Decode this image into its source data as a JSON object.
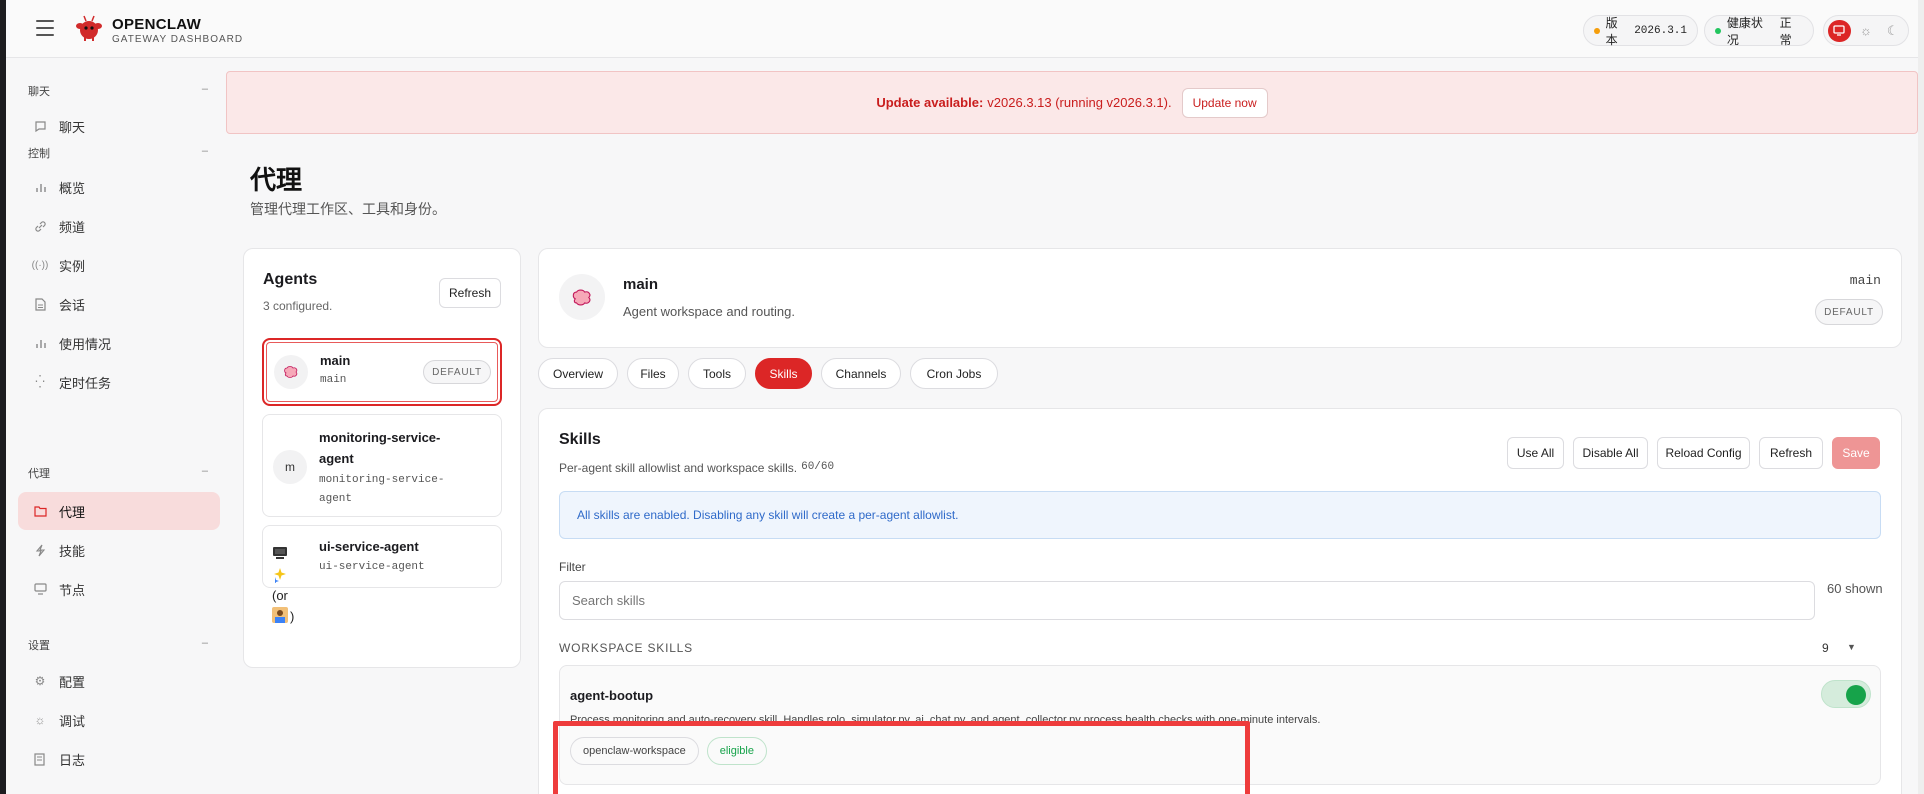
{
  "header": {
    "brand": "OPENCLAW",
    "brand_sub": "GATEWAY DASHBOARD",
    "version_label": "版本",
    "version_value": "2026.3.1",
    "health_label": "健康状况",
    "health_value": "正常",
    "version_dot_color": "#f59e0b",
    "health_dot_color": "#22c55e"
  },
  "sidebar": {
    "sections": [
      {
        "title": "聊天",
        "items": [
          {
            "label": "聊天",
            "icon": "chat-icon"
          }
        ]
      },
      {
        "title": "控制",
        "items": [
          {
            "label": "概览",
            "icon": "bar-chart-icon"
          },
          {
            "label": "频道",
            "icon": "link-icon"
          },
          {
            "label": "实例",
            "icon": "radio-icon"
          },
          {
            "label": "会话",
            "icon": "document-icon"
          },
          {
            "label": "使用情况",
            "icon": "bar-chart-icon"
          },
          {
            "label": "定时任务",
            "icon": "loader-icon"
          }
        ]
      },
      {
        "title": "代理",
        "items": [
          {
            "label": "代理",
            "icon": "folder-icon",
            "active": true
          },
          {
            "label": "技能",
            "icon": "bolt-icon"
          },
          {
            "label": "节点",
            "icon": "monitor-icon"
          }
        ]
      },
      {
        "title": "设置",
        "items": [
          {
            "label": "配置",
            "icon": "gear-icon"
          },
          {
            "label": "调试",
            "icon": "bug-icon"
          },
          {
            "label": "日志",
            "icon": "log-icon"
          }
        ]
      }
    ]
  },
  "banner": {
    "bold": "Update available:",
    "text": "v2026.3.13 (running v2026.3.1).",
    "button": "Update now"
  },
  "page": {
    "title": "代理",
    "subtitle": "管理代理工作区、工具和身份。"
  },
  "agents": {
    "title": "Agents",
    "count": "3 configured.",
    "refresh": "Refresh",
    "list": [
      {
        "name": "main",
        "id": "main",
        "badge": "DEFAULT"
      },
      {
        "name": "monitoring-service-agent",
        "id": "monitoring-service-agent",
        "avatar": "m"
      },
      {
        "name": "ui-service-agent",
        "id": "ui-service-agent",
        "extra_text": "(or",
        "extra_close": ")"
      }
    ]
  },
  "detail": {
    "name": "main",
    "desc": "Agent workspace and routing.",
    "id": "main",
    "badge": "DEFAULT"
  },
  "tabs": [
    "Overview",
    "Files",
    "Tools",
    "Skills",
    "Channels",
    "Cron Jobs"
  ],
  "active_tab": "Skills",
  "skills": {
    "title": "Skills",
    "subtitle": "Per-agent skill allowlist and workspace skills.",
    "count": "60/60",
    "buttons": {
      "use_all": "Use All",
      "disable_all": "Disable All",
      "reload": "Reload Config",
      "refresh": "Refresh",
      "save": "Save"
    },
    "info": "All skills are enabled. Disabling any skill will create a per-agent allowlist.",
    "filter_label": "Filter",
    "search_placeholder": "Search skills",
    "shown": "60 shown",
    "group_title": "WORKSPACE SKILLS",
    "group_count": "9",
    "items": [
      {
        "name": "agent-bootup",
        "desc": "Process monitoring and auto-recovery skill. Handles rolo_simulator.py, ai_chat.py, and agent_collector.py process health checks with one-minute intervals.",
        "tags": [
          "openclaw-workspace",
          "eligible"
        ],
        "enabled": true
      }
    ]
  }
}
